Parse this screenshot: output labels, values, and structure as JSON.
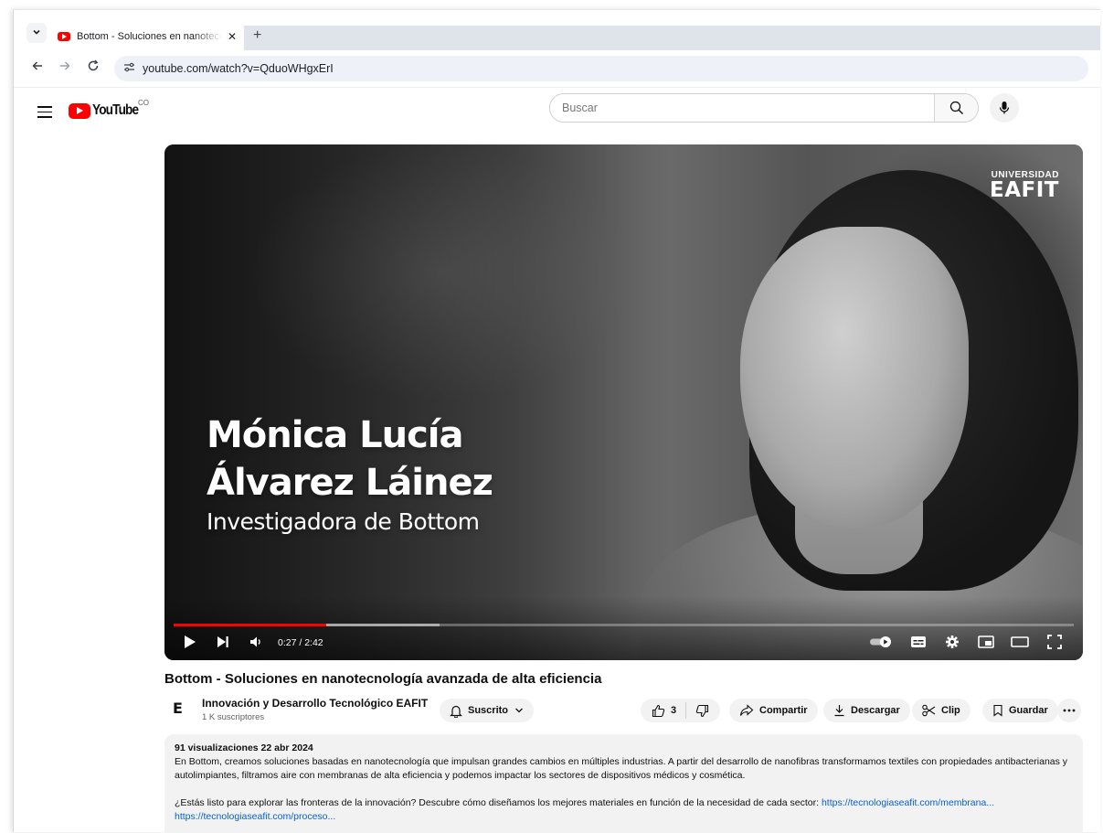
{
  "browser": {
    "tab_title": "Bottom - Soluciones en nanotecnología avanzada de alta eficiencia",
    "tab_close": "✕",
    "new_tab": "+",
    "url": "youtube.com/watch?v=QduoWHgxErI"
  },
  "youtube": {
    "logo_text": "YouTube",
    "country_code": "CO",
    "search_placeholder": "Buscar"
  },
  "player": {
    "brand_top": "UNIVERSIDAD",
    "brand_main": "EAFIT",
    "overlay_name_line1": "Mónica Lucía",
    "overlay_name_line2": "Álvarez Láinez",
    "overlay_role": "Investigadora de Bottom",
    "time_display": "0:27 / 2:42",
    "progress_played": 0.17,
    "progress_buffered": 0.295
  },
  "video": {
    "title": "Bottom - Soluciones en nanotecnología avanzada de alta eficiencia",
    "channel_initial": "E",
    "channel_name": "Innovación y Desarrollo Tecnológico EAFIT",
    "subscribers": "1 K suscriptores",
    "subscribe_label": "Suscrito",
    "like_count": "3",
    "share_label": "Compartir",
    "download_label": "Descargar",
    "clip_label": "Clip",
    "save_label": "Guardar"
  },
  "description": {
    "meta": "91 visualizaciones  22 abr 2024",
    "paragraph1": "En Bottom, creamos soluciones basadas en nanotecnología que impulsan grandes cambios en múltiples industrias. A partir del desarrollo de nanofibras transformamos textiles con propiedades antibacterianas y autolimpiantes,  filtramos aire con membranas de alta eficiencia y podemos impactar los sectores de dispositivos médicos y cosmética.",
    "paragraph2": "¿Estás listo para explorar las fronteras de la innovación? Descubre cómo diseñamos los mejores materiales en función de la necesidad de cada sector: ",
    "link1": "https://tecnologiaseafit.com/membrana...",
    "link2": "https://tecnologiaseafit.com/proceso..."
  },
  "colors": {
    "youtube_red": "#ff0000",
    "link_blue": "#065fd4"
  }
}
